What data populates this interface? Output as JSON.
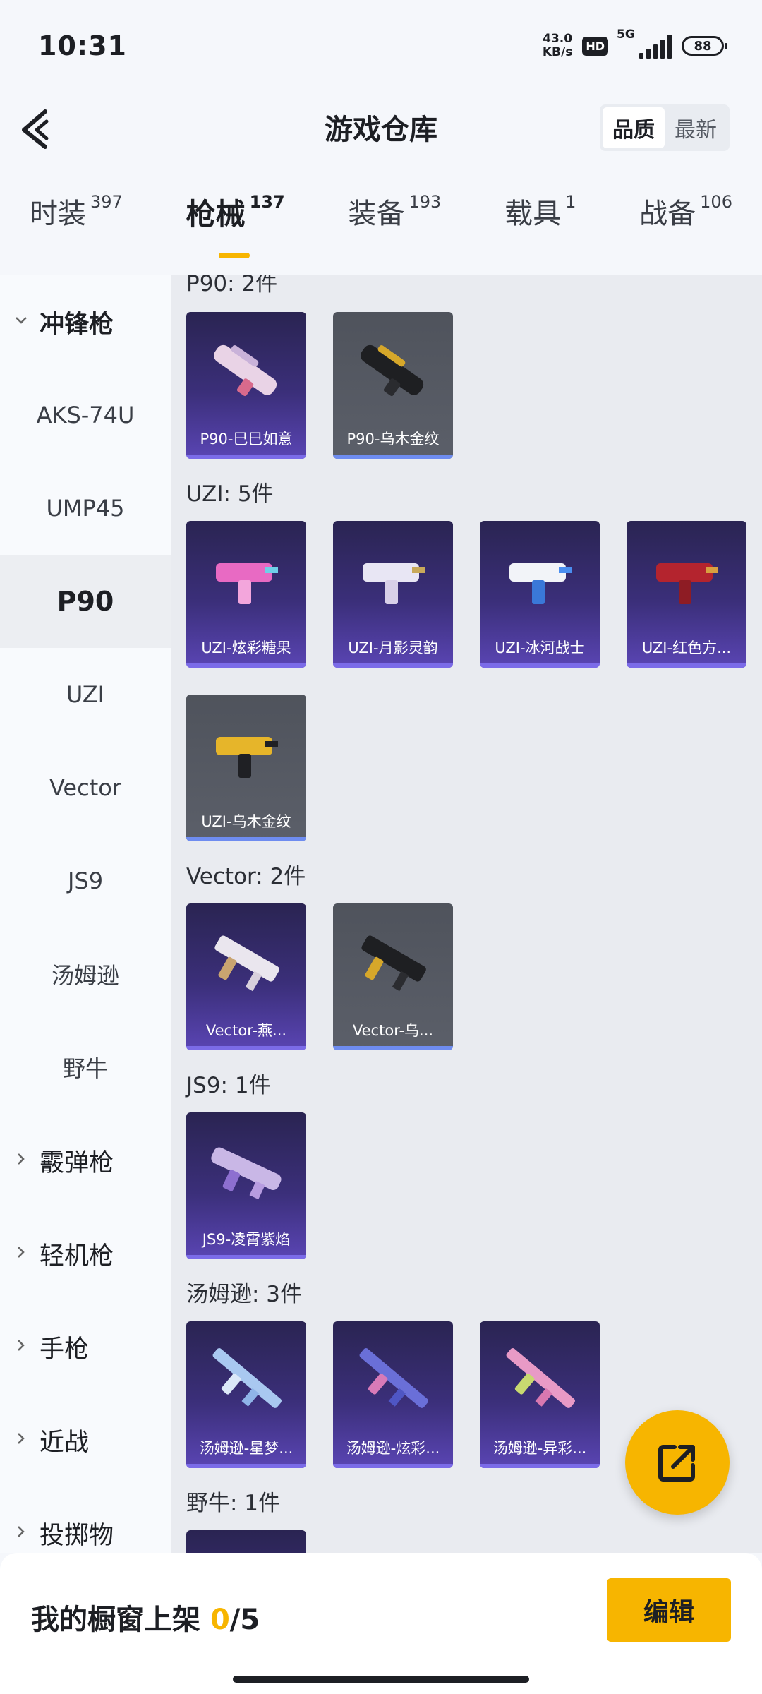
{
  "status_bar": {
    "time": "10:31",
    "net_speed_value": "43.0",
    "net_speed_unit": "KB/s",
    "hd": "HD",
    "network": "5G",
    "battery": "88"
  },
  "header": {
    "title": "游戏仓库",
    "sort_options": [
      "品质",
      "最新"
    ],
    "sort_selected": "品质"
  },
  "tabs": [
    {
      "label": "时装",
      "count": "397"
    },
    {
      "label": "枪械",
      "count": "137",
      "active": true
    },
    {
      "label": "装备",
      "count": "193"
    },
    {
      "label": "载具",
      "count": "1"
    },
    {
      "label": "战备",
      "count": "106"
    }
  ],
  "sidebar": {
    "items": [
      {
        "label": "冲锋枪",
        "type": "group",
        "expanded": true
      },
      {
        "label": "AKS-74U"
      },
      {
        "label": "UMP45"
      },
      {
        "label": "P90",
        "active": true
      },
      {
        "label": "UZI"
      },
      {
        "label": "Vector"
      },
      {
        "label": "JS9"
      },
      {
        "label": "汤姆逊"
      },
      {
        "label": "野牛"
      },
      {
        "label": "霰弹枪",
        "type": "group"
      },
      {
        "label": "轻机枪",
        "type": "group"
      },
      {
        "label": "手枪",
        "type": "group"
      },
      {
        "label": "近战",
        "type": "group"
      },
      {
        "label": "投掷物",
        "type": "group"
      }
    ]
  },
  "sections": [
    {
      "title": "P90: 2件",
      "items": [
        {
          "name": "P90-巳巳如意",
          "style": "purple"
        },
        {
          "name": "P90-乌木金纹",
          "style": "gray"
        }
      ]
    },
    {
      "title": "UZI: 5件",
      "items": [
        {
          "name": "UZI-炫彩糖果",
          "style": "purple"
        },
        {
          "name": "UZI-月影灵韵",
          "style": "purple"
        },
        {
          "name": "UZI-冰河战士",
          "style": "purple"
        },
        {
          "name": "UZI-红色方...",
          "style": "purple"
        },
        {
          "name": "UZI-乌木金纹",
          "style": "gray"
        }
      ]
    },
    {
      "title": "Vector: 2件",
      "items": [
        {
          "name": "Vector-燕...",
          "style": "purple"
        },
        {
          "name": "Vector-乌...",
          "style": "gray"
        }
      ]
    },
    {
      "title": "JS9: 1件",
      "items": [
        {
          "name": "JS9-凌霄紫焰",
          "style": "purple"
        }
      ]
    },
    {
      "title": "汤姆逊: 3件",
      "items": [
        {
          "name": "汤姆逊-星梦...",
          "style": "purple"
        },
        {
          "name": "汤姆逊-炫彩...",
          "style": "purple"
        },
        {
          "name": "汤姆逊-异彩...",
          "style": "purple"
        }
      ]
    },
    {
      "title": "野牛: 1件",
      "items": [
        {
          "name": "",
          "style": "purple"
        }
      ]
    }
  ],
  "showcase": {
    "label": "我的橱窗上架",
    "current": "0",
    "separator": "/",
    "max": "5",
    "edit_label": "编辑"
  },
  "colors": {
    "accent": "#f7b500",
    "card_purple": "#3b2f7a",
    "card_gray": "#565a64"
  }
}
